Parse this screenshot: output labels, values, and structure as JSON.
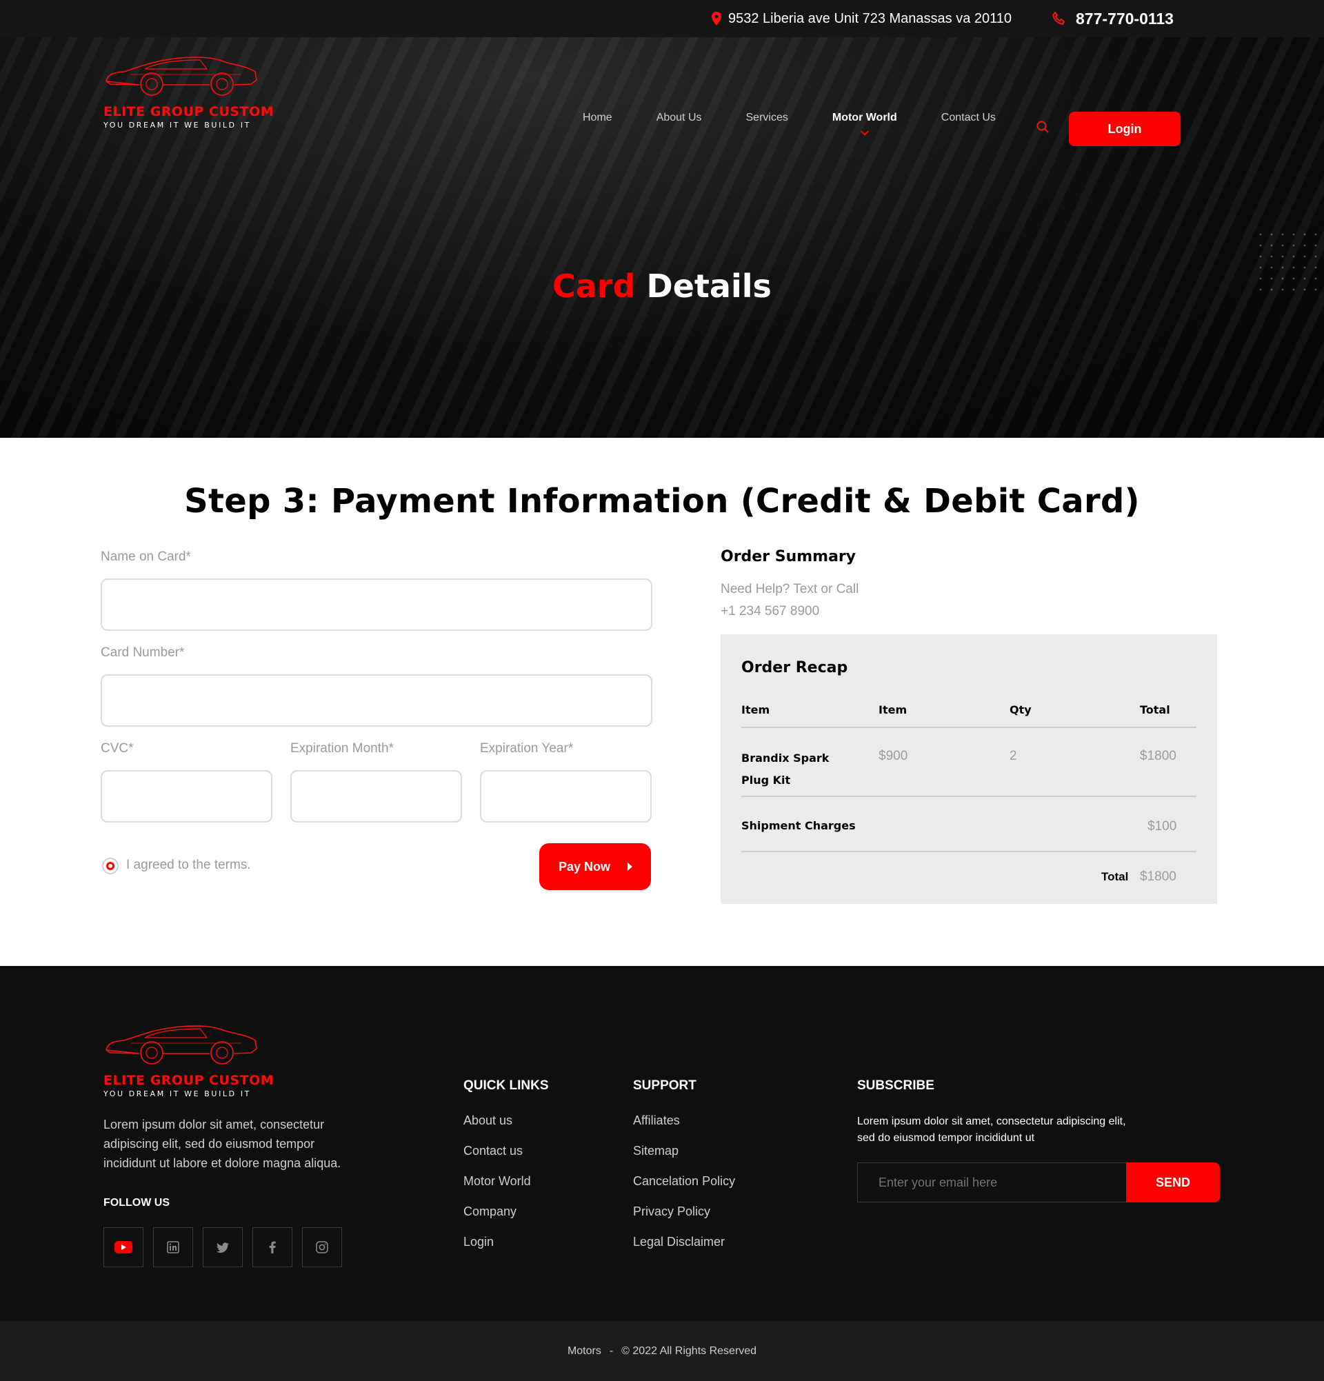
{
  "topbar": {
    "address": "9532 Liberia ave Unit 723 Manassas va 20110",
    "phone": "877-770-0113"
  },
  "logo": {
    "brand": "ELITE GROUP CUSTOM",
    "tagline": "YOU DREAM IT WE BUILD IT"
  },
  "nav": {
    "items": [
      {
        "label": "Home"
      },
      {
        "label": "About Us"
      },
      {
        "label": "Services"
      },
      {
        "label": "Motor World",
        "active": true
      },
      {
        "label": "Contact Us"
      }
    ],
    "search_icon": "search-icon",
    "login_label": "Login"
  },
  "hero": {
    "title_red": "Card",
    "title_white": "Details"
  },
  "payment": {
    "title": "Step 3: Payment Information (Credit & Debit Card)",
    "name_label": "Name on Card*",
    "name_value": "",
    "card_label": "Card Number*",
    "card_value": "",
    "cvc_label": "CVC*",
    "cvc_value": "",
    "month_label": "Expiration Month*",
    "month_value": "",
    "year_label": "Expiration Year*",
    "year_value": "",
    "terms_label": "I agreed to the terms.",
    "terms_checked": true,
    "pay_label": "Pay Now"
  },
  "summary": {
    "title": "Order Summary",
    "help_line1": "Need Help? Text or Call",
    "help_line2": "+1 234 567 8900",
    "recap_title": "Order Recap",
    "columns": [
      "Item",
      "Item",
      "Qty",
      "Total"
    ],
    "rows": [
      {
        "item_line1": "Brandix Spark",
        "item_line2": "Plug Kit",
        "price": "$900",
        "qty": "2",
        "total": "$1800"
      }
    ],
    "shipment_label": "Shipment Charges",
    "shipment_value": "$100",
    "total_label": "Total",
    "total_value": "$1800"
  },
  "footer": {
    "description": "Lorem ipsum dolor sit amet, consectetur adipiscing elit, sed do eiusmod tempor incididunt ut labore et dolore magna aliqua.",
    "follow_label": "FOLLOW US",
    "socials": [
      "youtube-icon",
      "linkedin-icon",
      "twitter-icon",
      "facebook-icon",
      "instagram-icon"
    ],
    "quick_links_title": "QUICK LINKS",
    "quick_links": [
      "About us",
      "Contact us",
      "Motor World",
      "Company",
      "Login"
    ],
    "support_title": "SUPPORT",
    "support_links": [
      "Affiliates",
      "Sitemap",
      "Cancelation Policy",
      "Privacy Policy",
      "Legal Disclaimer"
    ],
    "subscribe_title": "SUBSCRIBE",
    "subscribe_text": "Lorem ipsum dolor sit amet, consectetur adipiscing elit, sed do eiusmod tempor incididunt ut",
    "email_placeholder": "Enter your email here",
    "send_label": "SEND"
  },
  "copyright": {
    "site": "Motors",
    "separator": "-",
    "text": "© 2022 All Rights Reserved"
  },
  "colors": {
    "accent": "#ff0000",
    "dark": "#0f0f0f",
    "recap_bg": "#ebebeb"
  }
}
